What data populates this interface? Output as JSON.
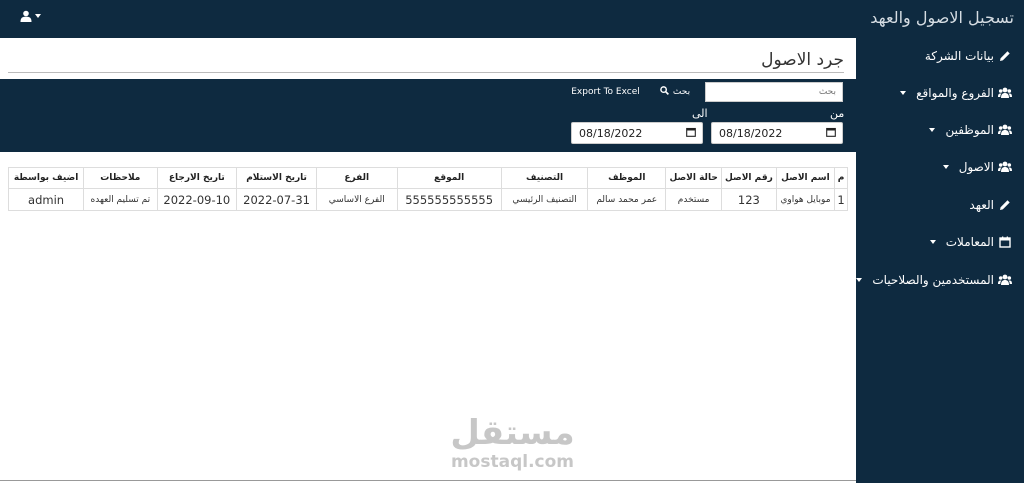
{
  "header": {
    "app_title": "تسجيل الاصول والعهد",
    "user_icon": "user-icon"
  },
  "sidebar": {
    "items": [
      {
        "label": "بيانات الشركة",
        "icon": "pencil-icon",
        "has_caret": false
      },
      {
        "label": "الفروع والمواقع",
        "icon": "users-icon",
        "has_caret": true
      },
      {
        "label": "الموظفين",
        "icon": "users-icon",
        "has_caret": true
      },
      {
        "label": "الاصول",
        "icon": "users-icon",
        "has_caret": true
      },
      {
        "label": "العهد",
        "icon": "pencil-icon",
        "has_caret": false
      },
      {
        "label": "المعاملات",
        "icon": "calendar-icon",
        "has_caret": true
      },
      {
        "label": "المستخدمين والصلاحيات",
        "icon": "users-icon",
        "has_caret": true
      }
    ]
  },
  "main": {
    "page_title": "جرد الاصول",
    "search": {
      "placeholder": "بحث",
      "button_label": "بحث"
    },
    "export_label": "Export To Excel",
    "from_label": "من",
    "to_label": "الى",
    "date_from": "08/18/2022",
    "date_to": "08/18/2022",
    "table": {
      "headers": [
        "م",
        "اسم الاصل",
        "رقم الاصل",
        "حالة الاصل",
        "الموظف",
        "التصنيف",
        "الموقع",
        "الفرع",
        "تاريخ الاستلام",
        "تاريخ الارجاع",
        "ملاحظات",
        "اضيف بواسطة"
      ],
      "rows": [
        [
          "1",
          "موبايل هواوي",
          "123",
          "مستخدم",
          "عمر محمد سالم",
          "التصنيف الرئيسي",
          "555555555555",
          "الفرع الاساسي",
          "2022-07-31",
          "2022-09-10",
          "تم تسليم العهده",
          "admin"
        ]
      ]
    }
  },
  "watermark": {
    "arabic": "مستقل",
    "latin": "mostaql.com"
  },
  "colors": {
    "navy": "#0e2a40",
    "white": "#ffffff"
  }
}
